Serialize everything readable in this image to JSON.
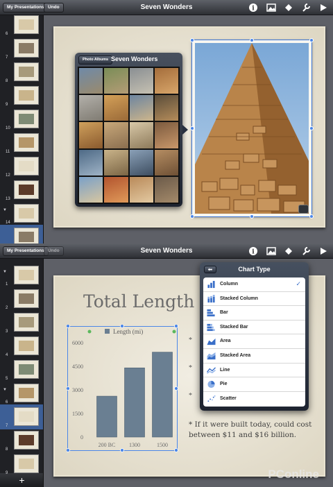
{
  "top_screen": {
    "toolbar": {
      "left_button": "My Presentations",
      "undo": "Undo",
      "title": "Seven Wonders",
      "icons": [
        "info-icon",
        "media-icon",
        "shapes-icon",
        "wrench-icon",
        "play-icon"
      ]
    },
    "sidebar": {
      "rows": [
        {
          "num": "6",
          "selected": false,
          "disclosure": false
        },
        {
          "num": "7",
          "selected": false,
          "disclosure": false
        },
        {
          "num": "8",
          "selected": false,
          "disclosure": false
        },
        {
          "num": "9",
          "selected": false,
          "disclosure": false
        },
        {
          "num": "10",
          "selected": false,
          "disclosure": false
        },
        {
          "num": "11",
          "selected": false,
          "disclosure": false
        },
        {
          "num": "12",
          "selected": false,
          "disclosure": false
        },
        {
          "num": "13",
          "selected": false,
          "disclosure": false
        },
        {
          "num": "14",
          "selected": false,
          "disclosure": true
        },
        {
          "num": "15",
          "selected": true,
          "disclosure": false
        }
      ]
    },
    "photo_popover": {
      "back_button": "Photo Albums",
      "title": "Seven Wonders",
      "photo_count": 20
    }
  },
  "bottom_screen": {
    "toolbar": {
      "left_button": "My Presentations",
      "undo": "Undo",
      "title": "Seven Wonders"
    },
    "sidebar": {
      "rows": [
        {
          "num": "1",
          "selected": false,
          "disclosure": true
        },
        {
          "num": "2",
          "selected": false,
          "disclosure": false
        },
        {
          "num": "3",
          "selected": false,
          "disclosure": false
        },
        {
          "num": "4",
          "selected": false,
          "disclosure": false
        },
        {
          "num": "5",
          "selected": false,
          "disclosure": false
        },
        {
          "num": "6",
          "selected": false,
          "disclosure": true
        },
        {
          "num": "7",
          "selected": true,
          "disclosure": false
        },
        {
          "num": "8",
          "selected": false,
          "disclosure": false
        },
        {
          "num": "9",
          "selected": false,
          "disclosure": false
        }
      ],
      "add_label": "+"
    },
    "slide": {
      "title": "Total Length",
      "bullet_glyph": "*",
      "last_bullet": "If it were built today, could cost between $11 and $16 billion."
    },
    "chart_popover": {
      "title": "Chart Type",
      "back": "⬅",
      "selected": "Column",
      "items": [
        {
          "label": "Column",
          "icon": "column-chart-icon"
        },
        {
          "label": "Stacked Column",
          "icon": "stacked-column-icon"
        },
        {
          "label": "Bar",
          "icon": "bar-chart-icon"
        },
        {
          "label": "Stacked Bar",
          "icon": "stacked-bar-icon"
        },
        {
          "label": "Area",
          "icon": "area-chart-icon"
        },
        {
          "label": "Stacked Area",
          "icon": "stacked-area-icon"
        },
        {
          "label": "Line",
          "icon": "line-chart-icon"
        },
        {
          "label": "Pie",
          "icon": "pie-chart-icon"
        },
        {
          "label": "Scatter",
          "icon": "scatter-chart-icon"
        }
      ]
    },
    "watermark": "PConline"
  },
  "chart_data": {
    "type": "bar",
    "categories": [
      "200 BC",
      "1300",
      "1500"
    ],
    "series": [
      {
        "name": "Length (mi)",
        "values": [
          2600,
          4400,
          5400
        ]
      }
    ],
    "yticks": [
      "6000",
      "4500",
      "3000",
      "1500",
      "0"
    ],
    "ylim": [
      0,
      6000
    ],
    "legend_position": "top",
    "color": "#6a7f92"
  }
}
